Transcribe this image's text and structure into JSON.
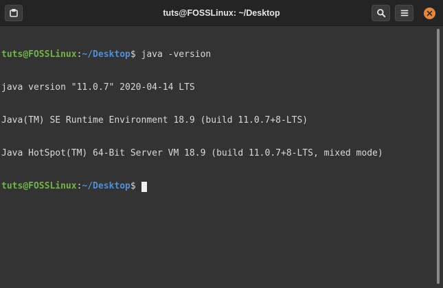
{
  "window": {
    "title": "tuts@FOSSLinux: ~/Desktop"
  },
  "titlebar": {
    "new_tab_icon": "new-tab-icon",
    "search_icon": "search-icon",
    "menu_icon": "hamburger-menu-icon",
    "close_icon": "close-icon"
  },
  "prompt": {
    "user_host": "tuts@FOSSLinux",
    "separator": ":",
    "path": "~/Desktop",
    "symbol": "$ "
  },
  "terminal": {
    "command": "java -version",
    "output": [
      "java version \"11.0.7\" 2020-04-14 LTS",
      "Java(TM) SE Runtime Environment 18.9 (build 11.0.7+8-LTS)",
      "Java HotSpot(TM) 64-Bit Server VM 18.9 (build 11.0.7+8-LTS, mixed mode)"
    ]
  },
  "colors": {
    "background": "#333333",
    "titlebar": "#242424",
    "prompt_user": "#72b34a",
    "prompt_path": "#4f8fd6",
    "close_button": "#e8873a"
  }
}
